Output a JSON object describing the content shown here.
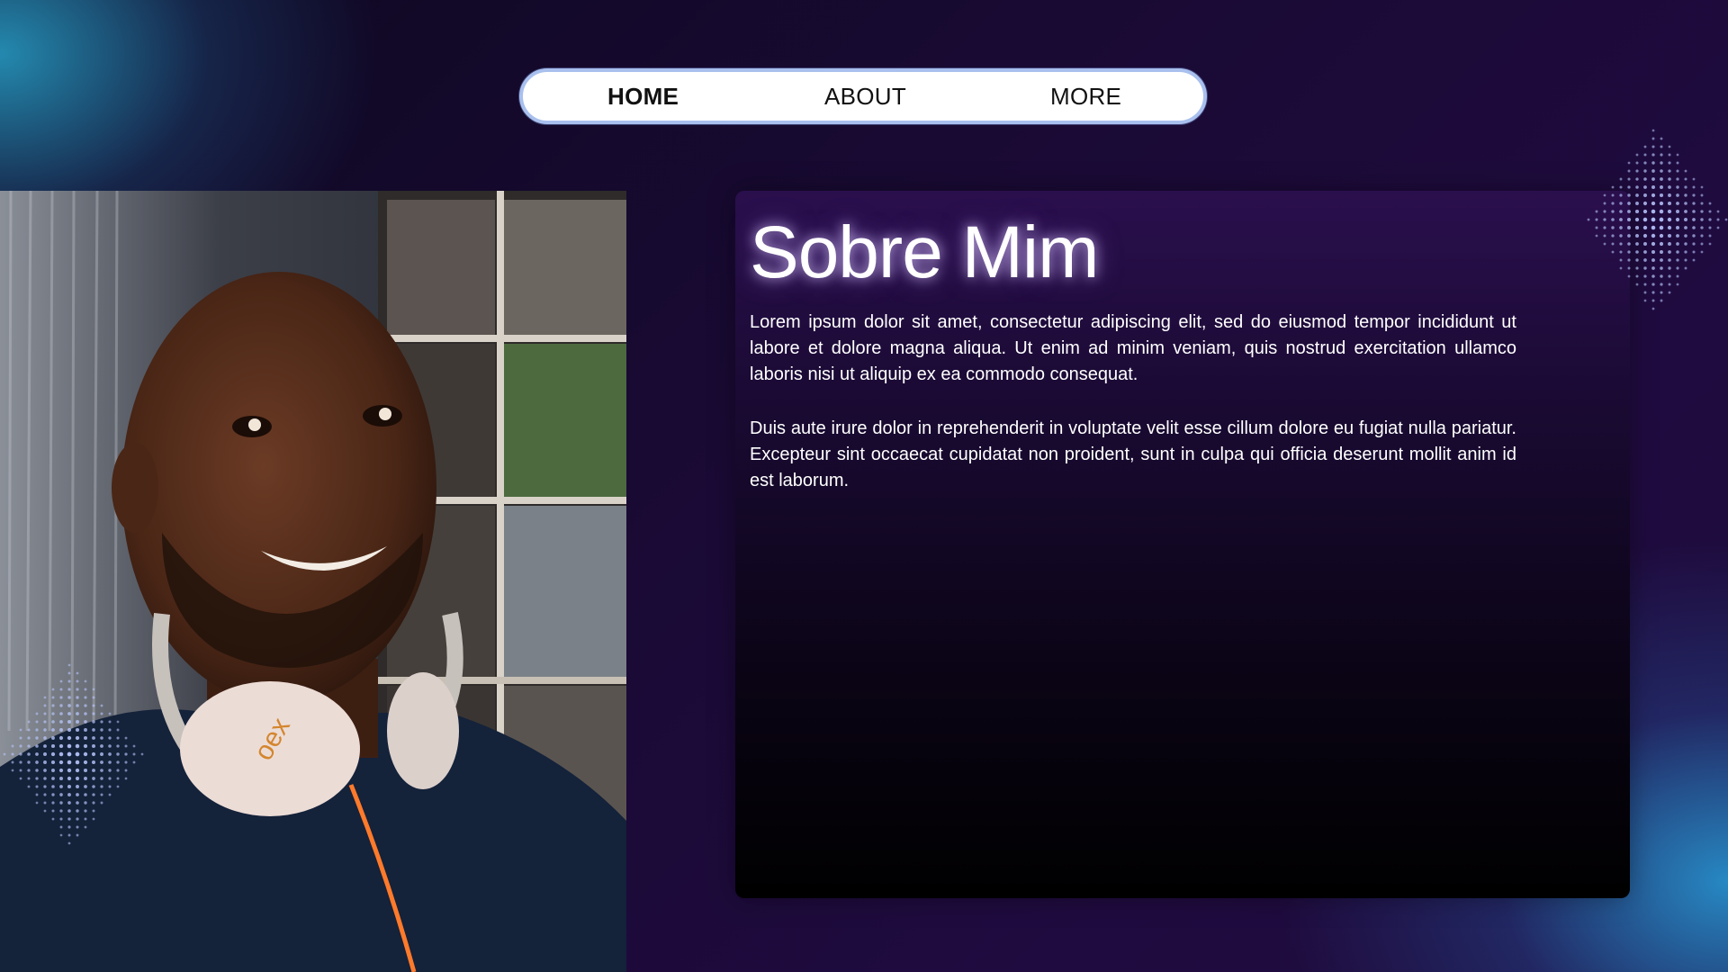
{
  "nav": {
    "home": "HOME",
    "about": "ABOUT",
    "more": "MORE"
  },
  "about": {
    "title": "Sobre Mim",
    "paragraph1": "Lorem ipsum dolor sit amet, consectetur adipiscing elit, sed do eiusmod tempor incididunt ut labore et dolore magna aliqua. Ut enim ad minim veniam, quis nostrud exercitation ullamco laboris nisi ut aliquip ex ea commodo consequat.",
    "paragraph2": "Duis aute irure dolor in reprehenderit in voluptate velit esse cillum dolore eu fugiat nulla pariatur. Excepteur sint occaecat cupidatat non proident, sunt in culpa qui officia deserunt mollit anim id est laborum."
  },
  "photo": {
    "headphone_brand": "oex"
  },
  "colors": {
    "nav_border": "#a9c0ee",
    "accent_glow": "#c8b4ff",
    "dots": "#b9c8ff"
  }
}
